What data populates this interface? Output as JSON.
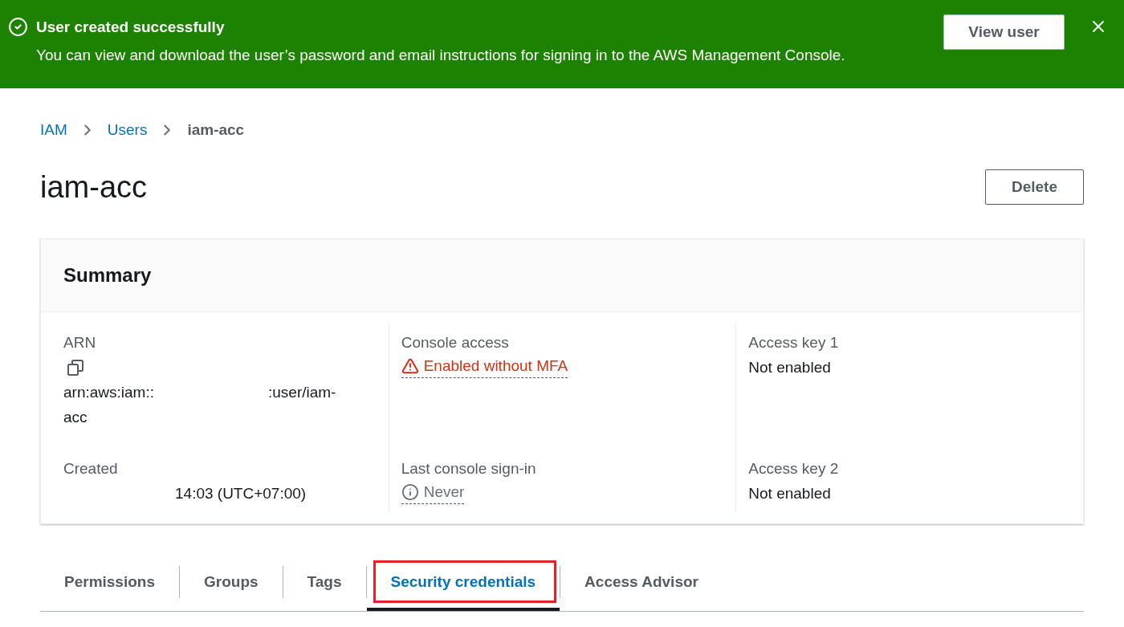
{
  "flash": {
    "kind": "success",
    "title": "User created successfully",
    "message": "You can view and download the user’s password and email instructions for signing in to the AWS Management Console.",
    "action": "View user",
    "dismissible": true
  },
  "breadcrumbs": [
    {
      "label": "IAM",
      "current": false
    },
    {
      "label": "Users",
      "current": false
    },
    {
      "label": "iam-acc",
      "current": true
    }
  ],
  "page_title": "iam-acc",
  "header_action": "Delete",
  "summary": {
    "title": "Summary",
    "columns": [
      [
        {
          "label": "ARN",
          "kind": "copyable",
          "parts": [
            "arn:aws:iam::",
            ":user/iam-acc"
          ]
        },
        {
          "label": "Created",
          "kind": "masked",
          "value": "14:03 (UTC+07:00)"
        }
      ],
      [
        {
          "label": "Console access",
          "kind": "warning",
          "value": "Enabled without MFA"
        },
        {
          "label": "Last console sign-in",
          "kind": "info",
          "value": "Never"
        }
      ],
      [
        {
          "label": "Access key 1",
          "kind": "text",
          "value": "Not enabled"
        },
        {
          "label": "Access key 2",
          "kind": "text",
          "value": "Not enabled"
        }
      ]
    ]
  },
  "tabs": [
    {
      "label": "Permissions",
      "selected": false,
      "annotated": false
    },
    {
      "label": "Groups",
      "selected": false,
      "annotated": false
    },
    {
      "label": "Tags",
      "selected": false,
      "annotated": false
    },
    {
      "label": "Security credentials",
      "selected": true,
      "annotated": true
    },
    {
      "label": "Access Advisor",
      "selected": false,
      "annotated": false
    }
  ]
}
